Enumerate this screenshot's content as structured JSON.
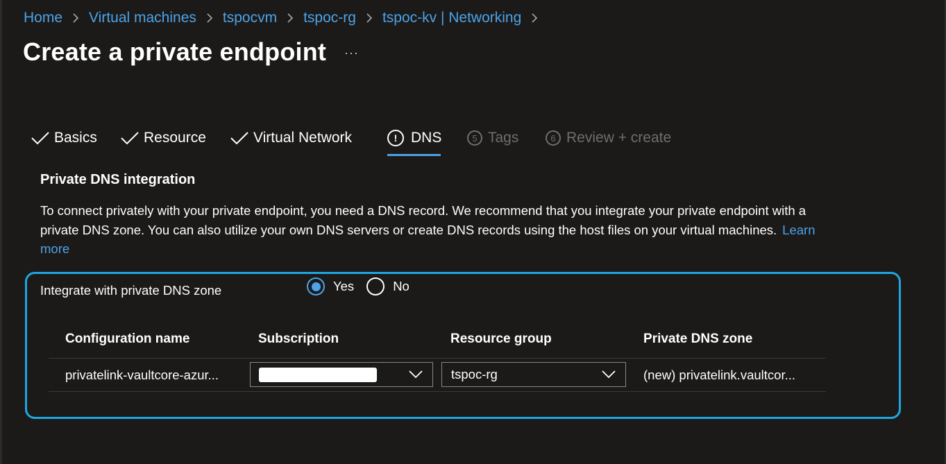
{
  "breadcrumb": {
    "items": [
      "Home",
      "Virtual machines",
      "tspocvm",
      "tspoc-rg",
      "tspoc-kv | Networking"
    ]
  },
  "page": {
    "title": "Create a private endpoint",
    "more_label": "···"
  },
  "tabs": [
    {
      "label": "Basics",
      "state": "complete"
    },
    {
      "label": "Resource",
      "state": "complete"
    },
    {
      "label": "Virtual Network",
      "state": "complete"
    },
    {
      "label": "DNS",
      "state": "active-warning",
      "icon": "!"
    },
    {
      "label": "Tags",
      "state": "disabled",
      "number": "5"
    },
    {
      "label": "Review + create",
      "state": "disabled",
      "number": "6"
    }
  ],
  "section": {
    "title": "Private DNS integration",
    "description": "To connect privately with your private endpoint, you need a DNS record. We recommend that you integrate your private endpoint with a private DNS zone. You can also utilize your own DNS servers or create DNS records using the host files on your virtual machines.",
    "learn_more": "Learn more"
  },
  "integrate": {
    "label": "Integrate with private DNS zone",
    "options": [
      {
        "label": "Yes",
        "checked": true
      },
      {
        "label": "No",
        "checked": false
      }
    ]
  },
  "grid": {
    "headers": [
      "Configuration name",
      "Subscription",
      "Resource group",
      "Private DNS zone"
    ],
    "row": {
      "configuration_name": "privatelink-vaultcore-azur...",
      "subscription": "",
      "resource_group": "tspoc-rg",
      "private_dns_zone": "(new) privatelink.vaultcor..."
    }
  },
  "colors": {
    "background": "#1b1a19",
    "accent": "#4ca3e8",
    "highlight_border": "#1ea7e1",
    "disabled": "#6e6e6e"
  }
}
